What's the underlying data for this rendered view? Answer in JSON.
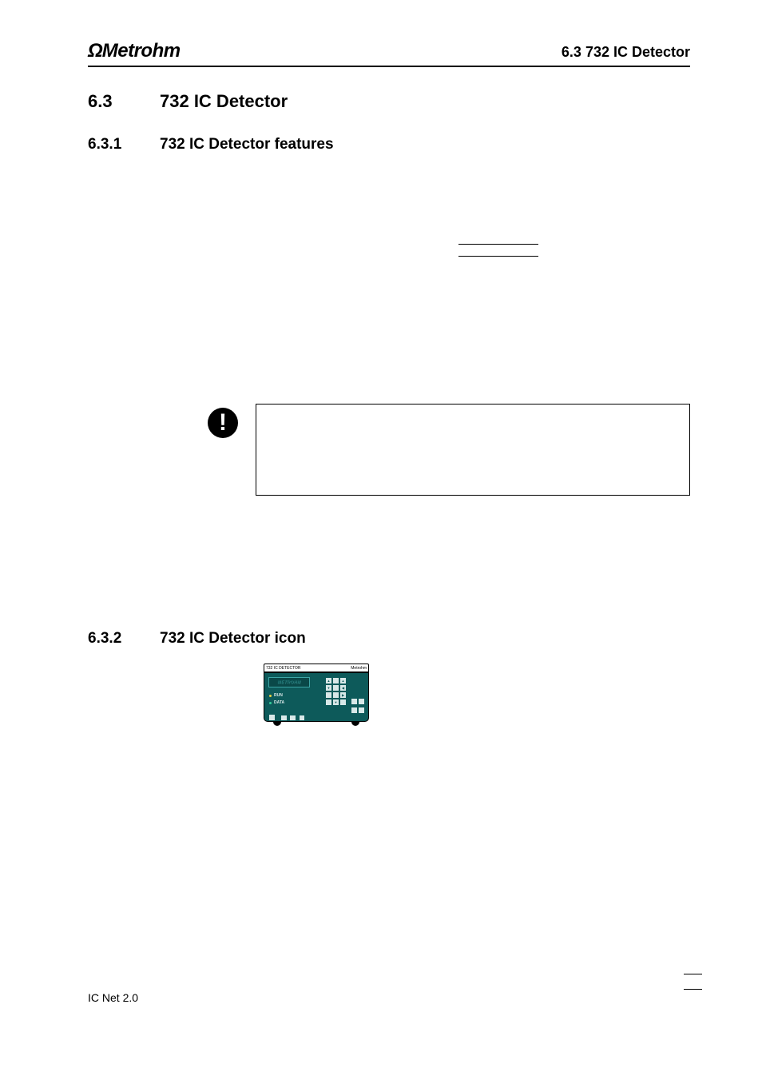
{
  "logo": {
    "brand": "Metrohm",
    "omega": "Ω"
  },
  "header": {
    "right": "6.3  732 IC Detector"
  },
  "section": {
    "number": "6.3",
    "title": "732 IC Detector"
  },
  "subsection1": {
    "number": "6.3.1",
    "title": "732 IC Detector features"
  },
  "subsection2": {
    "number": "6.3.2",
    "title": "732 IC Detector icon"
  },
  "detector": {
    "left_label": "732  IC  DETECTOR",
    "right_label": "Metrohm",
    "run": "RUN",
    "data": "DATA",
    "brand_screen": "METROHM"
  },
  "footer": {
    "label": "IC Net 2.0"
  }
}
